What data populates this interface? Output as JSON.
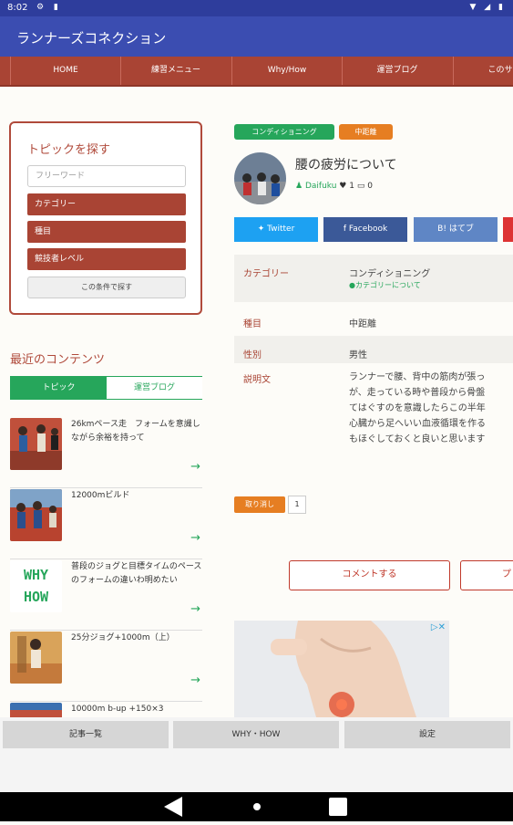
{
  "status": {
    "time": "8:02"
  },
  "app": {
    "title": "ランナーズコネクション"
  },
  "nav": [
    "HOME",
    "練習メニュー",
    "Why/How",
    "運営ブログ",
    "このサイト"
  ],
  "search": {
    "title": "トピックを探す",
    "free_word_placeholder": "フリーワード",
    "category": "カテゴリー",
    "event": "種目",
    "level": "競技者レベル",
    "submit": "この条件で探す"
  },
  "recent": {
    "title": "最近のコンテンツ",
    "tab_topic": "トピック",
    "tab_blog": "運営ブログ",
    "items": [
      {
        "text": "26kmペース走　フォームを意識しながら余裕を持って"
      },
      {
        "text": "12000mビルド"
      },
      {
        "text": "普段のジョグと目標タイムのペースのフォームの違いわ明めたい",
        "logo_line1": "WHY",
        "logo_line2": "HOW"
      },
      {
        "text": "25分ジョグ+1000m（上）"
      },
      {
        "text": "10000m b-up +150×3"
      }
    ],
    "arrow": "→"
  },
  "post": {
    "tags": [
      {
        "label": "コンディショニング",
        "color": "#26a65b"
      },
      {
        "label": "中距離",
        "color": "#e67e22"
      }
    ],
    "title": "腰の疲労について",
    "author": "Daifuku",
    "likes": "1",
    "comments": "0",
    "share": {
      "twitter": "Twitter",
      "facebook": "Facebook",
      "hatena": "はてブ"
    },
    "info": {
      "category_label": "カテゴリー",
      "category_value": "コンディショニング",
      "category_link": "●カテゴリーについて",
      "event_label": "種目",
      "event_value": "中距離",
      "gender_label": "性別",
      "gender_value": "男性",
      "desc_label": "説明文",
      "desc_lines": [
        "ランナーで腰、背中の筋肉が張っ",
        "が、走っている時や普段から骨盤",
        "てはぐすのを意識したらこの半年",
        "心臓から足へいい血液循環を作る",
        "もほぐしておくと良いと思います"
      ]
    },
    "cancel_label": "取り消し",
    "cancel_count": "1",
    "comment_button": "コメントする",
    "comment_button2": "プ"
  },
  "bottom": {
    "articles": "記事一覧",
    "whyhow": "WHY・HOW",
    "settings": "設定"
  }
}
